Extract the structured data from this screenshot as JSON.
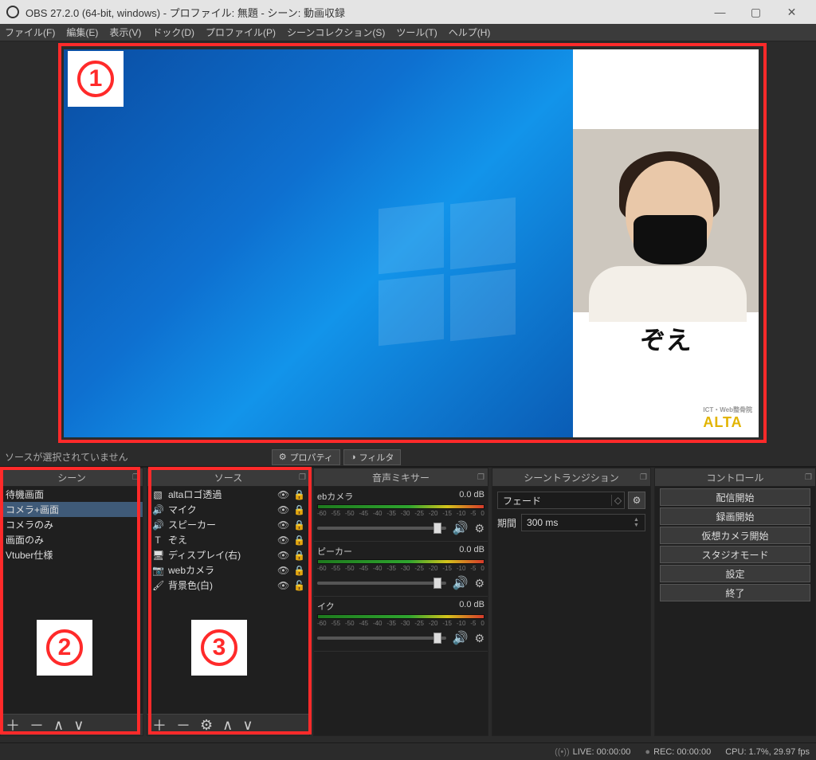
{
  "window": {
    "title": "OBS 27.2.0 (64-bit, windows) - プロファイル: 無題 - シーン: 動画収録"
  },
  "menu": {
    "file": "ファイル(F)",
    "edit": "編集(E)",
    "view": "表示(V)",
    "dock": "ドック(D)",
    "profile": "プロファイル(P)",
    "scene_collection": "シーンコレクション(S)",
    "tools": "ツール(T)",
    "help": "ヘルプ(H)"
  },
  "preview": {
    "overlay_name": "ぞえ",
    "logo_small": "ICT・Web整骨院",
    "logo_text": "ALTA",
    "annotation_1": "1",
    "annotation_2": "2",
    "annotation_3": "3"
  },
  "toolbar": {
    "no_selection": "ソースが選択されていません",
    "properties": "プロパティ",
    "filters": "フィルタ"
  },
  "docks": {
    "scenes_title": "シーン",
    "sources_title": "ソース",
    "mixer_title": "音声ミキサー",
    "transition_title": "シーントランジション",
    "controls_title": "コントロール"
  },
  "scenes": [
    {
      "label": "待機画面"
    },
    {
      "label": "コメラ+画面"
    },
    {
      "label": "コメラのみ"
    },
    {
      "label": "画面のみ"
    },
    {
      "label": "Vtuber仕様"
    }
  ],
  "sources": [
    {
      "icon": "▧",
      "label": "altaロゴ透過",
      "locked": true
    },
    {
      "icon": "🔊",
      "label": "マイク",
      "locked": true
    },
    {
      "icon": "🔊",
      "label": "スピーカー",
      "locked": true
    },
    {
      "icon": "T",
      "label": "ぞえ",
      "locked": true
    },
    {
      "icon": "🖥",
      "label": "ディスプレイ(右)",
      "locked": true
    },
    {
      "icon": "📷",
      "label": "webカメラ",
      "locked": true
    },
    {
      "icon": "🖌",
      "label": "背景色(白)",
      "locked": false
    }
  ],
  "mixer": {
    "channels": [
      {
        "name": "ebカメラ",
        "level": "0.0 dB"
      },
      {
        "name": "ピーカー",
        "level": "0.0 dB"
      },
      {
        "name": "イク",
        "level": "0.0 dB"
      }
    ],
    "ticks": [
      "-60",
      "-55",
      "-50",
      "-45",
      "-40",
      "-35",
      "-30",
      "-25",
      "-20",
      "-15",
      "-10",
      "-5",
      "0"
    ]
  },
  "transition": {
    "type": "フェード",
    "duration_label": "期間",
    "duration_value": "300 ms"
  },
  "controls": {
    "start_stream": "配信開始",
    "start_record": "録画開始",
    "start_vcam": "仮想カメラ開始",
    "studio_mode": "スタジオモード",
    "settings": "設定",
    "exit": "終了"
  },
  "status": {
    "live": "LIVE: 00:00:00",
    "rec": "REC: 00:00:00",
    "cpu": "CPU: 1.7%, 29.97 fps"
  }
}
